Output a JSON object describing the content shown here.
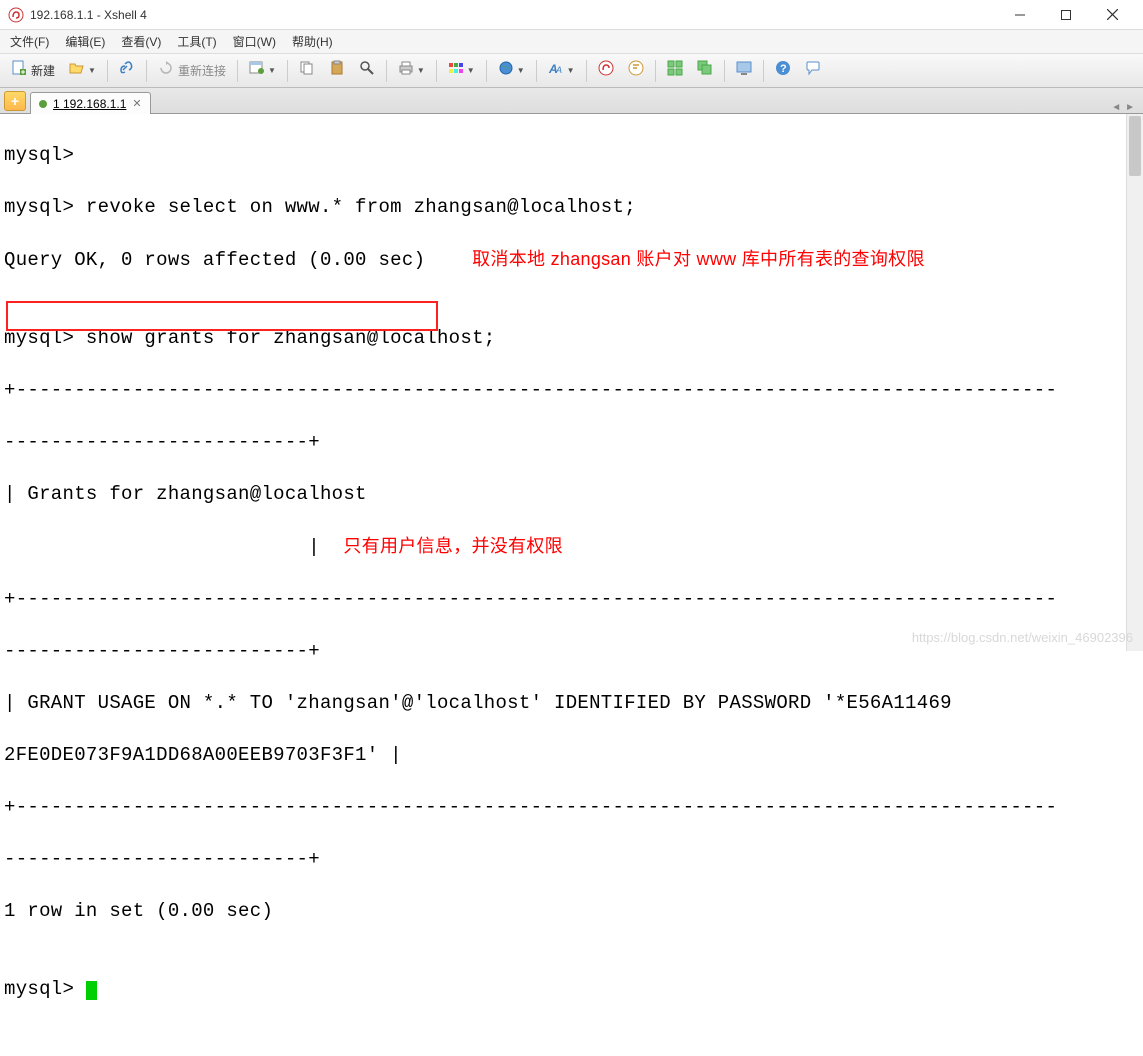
{
  "window": {
    "title": "192.168.1.1 - Xshell 4"
  },
  "menu": {
    "file": "文件(F)",
    "edit": "编辑(E)",
    "view": "查看(V)",
    "tools": "工具(T)",
    "window": "窗口(W)",
    "help": "帮助(H)"
  },
  "toolbar": {
    "new_label": "新建",
    "reconnect_label": "重新连接"
  },
  "tab": {
    "label": "1 192.168.1.1"
  },
  "terminal": {
    "l1": "mysql>",
    "l2": "mysql> revoke select on www.* from zhangsan@localhost;",
    "l3": "Query OK, 0 rows affected (0.00 sec)",
    "anno1": "取消本地 zhangsan 账户对 www 库中所有表的查询权限",
    "l4": "",
    "l5": "mysql> show grants for zhangsan@localhost;",
    "l6": "+-----------------------------------------------------------------------------------------",
    "l7": "--------------------------+",
    "l8": "| Grants for zhangsan@localhost                                                           ",
    "l9pre": "                          |  ",
    "anno2": "只有用户信息，并没有权限",
    "l10": "+-----------------------------------------------------------------------------------------",
    "l11": "--------------------------+",
    "l12": "| GRANT USAGE ON *.* TO 'zhangsan'@'localhost' IDENTIFIED BY PASSWORD '*E56A11469",
    "l13": "2FE0DE073F9A1DD68A00EEB9703F3F1' |",
    "l14": "+-----------------------------------------------------------------------------------------",
    "l15": "--------------------------+",
    "l16": "1 row in set (0.00 sec)",
    "l17": "",
    "l18": "mysql> "
  },
  "watermark": "https://blog.csdn.net/weixin_46902396"
}
